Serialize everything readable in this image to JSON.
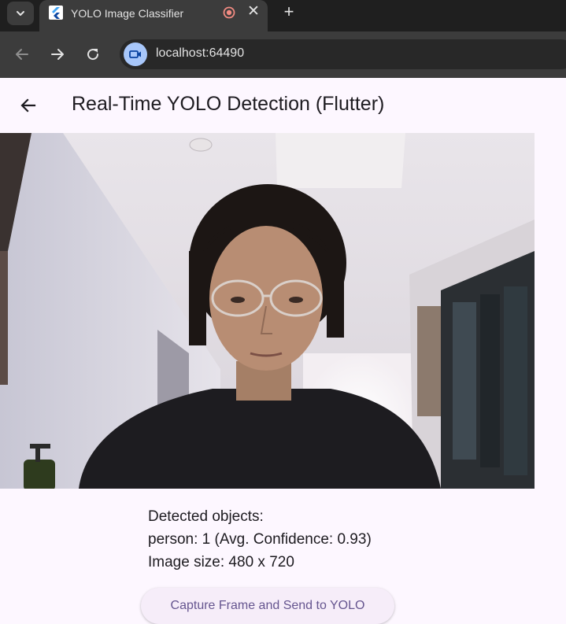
{
  "browser": {
    "tab_title": "YOLO Image Classifier",
    "tab_close_glyph": "✕",
    "new_tab_glyph": "+",
    "url": "localhost:64490",
    "icons": [
      "tab-search-icon",
      "flutter-icon",
      "recording-icon",
      "close-icon",
      "plus-icon",
      "back-icon",
      "forward-icon",
      "reload-icon",
      "camera-in-use-icon"
    ]
  },
  "app": {
    "title": "Real-Time YOLO Detection (Flutter)",
    "back_icon": "arrow-left-icon",
    "camera_preview": "live camera feed showing a person"
  },
  "results": {
    "heading": "Detected objects:",
    "detection_line": "person: 1 (Avg. Confidence: 0.93)",
    "size_line": "Image size: 480 x 720"
  },
  "actions": {
    "capture_label": "Capture Frame and Send to YOLO"
  },
  "colors": {
    "chrome_dark": "#1f1f1f",
    "chrome_toolbar": "#3c3c3c",
    "app_background": "#fdf7ff",
    "button_text": "#65558f",
    "button_background": "#f6edf9"
  }
}
